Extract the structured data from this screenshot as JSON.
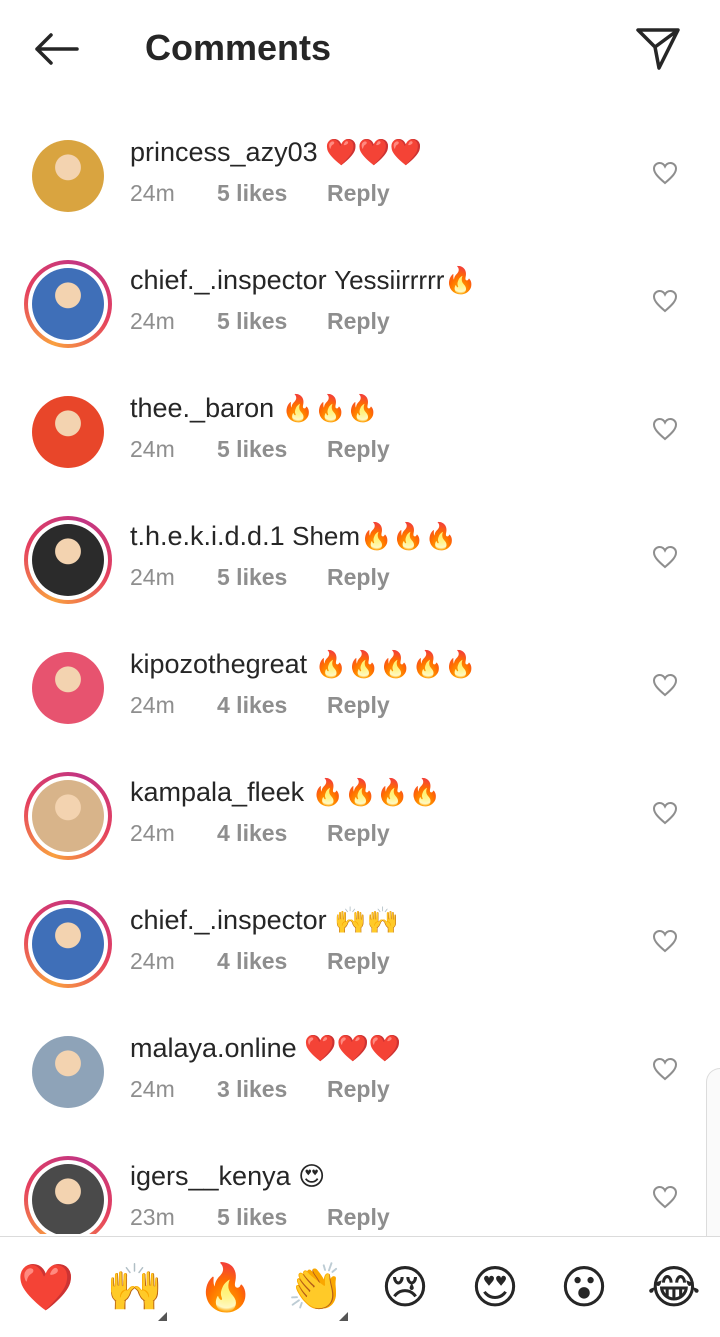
{
  "header": {
    "title": "Comments"
  },
  "comments": [
    {
      "username": "princess_azy03",
      "text": "❤️❤️❤️",
      "time": "24m",
      "likes": "5 likes",
      "reply": "Reply",
      "ring": false,
      "avatar_color": "#d9a440"
    },
    {
      "username": "chief._.inspector",
      "text": "Yessiirrrrr🔥",
      "time": "24m",
      "likes": "5 likes",
      "reply": "Reply",
      "ring": true,
      "avatar_color": "#3f6fb8"
    },
    {
      "username": "thee._baron",
      "text": "🔥🔥🔥",
      "time": "24m",
      "likes": "5 likes",
      "reply": "Reply",
      "ring": false,
      "avatar_color": "#e8462a"
    },
    {
      "username": "t.h.e.k.i.d.d.1",
      "text": "Shem🔥🔥🔥",
      "time": "24m",
      "likes": "5 likes",
      "reply": "Reply",
      "ring": true,
      "avatar_color": "#2b2b2b"
    },
    {
      "username": "kipozothegreat",
      "text": "🔥🔥🔥🔥🔥",
      "time": "24m",
      "likes": "4 likes",
      "reply": "Reply",
      "ring": false,
      "avatar_color": "#e7536f"
    },
    {
      "username": "kampala_fleek",
      "text": "🔥🔥🔥🔥",
      "time": "24m",
      "likes": "4 likes",
      "reply": "Reply",
      "ring": true,
      "avatar_color": "#d8b48a"
    },
    {
      "username": "chief._.inspector",
      "text": "🙌🙌",
      "time": "24m",
      "likes": "4 likes",
      "reply": "Reply",
      "ring": true,
      "avatar_color": "#3f6fb8"
    },
    {
      "username": "malaya.online",
      "text": "❤️❤️❤️",
      "time": "24m",
      "likes": "3 likes",
      "reply": "Reply",
      "ring": false,
      "avatar_color": "#8ea3b8"
    },
    {
      "username": "igers__kenya",
      "text": "😍",
      "time": "23m",
      "likes": "5 likes",
      "reply": "Reply",
      "ring": true,
      "avatar_color": "#4a4a4a"
    }
  ],
  "emoji_bar": [
    "❤️",
    "🙌",
    "🔥",
    "👏",
    "😢",
    "😍",
    "😮",
    "😂"
  ],
  "colors": {
    "heart_outline": "#8e8e8e",
    "meta_text": "#8e8e8e",
    "ring_start": "#f9a03f",
    "ring_end": "#c13584"
  }
}
